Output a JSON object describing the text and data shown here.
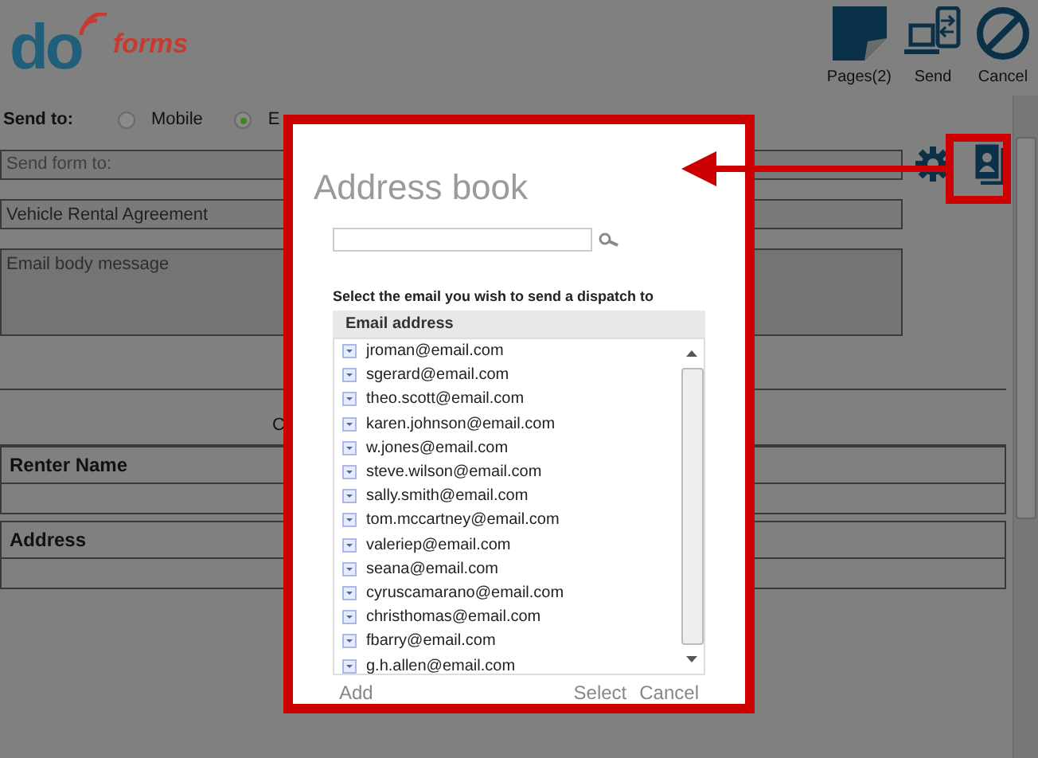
{
  "logo": {
    "mark": "do",
    "name": "forms"
  },
  "toolbar": [
    {
      "label": "Pages(2)",
      "kind": "pages"
    },
    {
      "label": "Send",
      "kind": "send"
    },
    {
      "label": "Cancel",
      "kind": "cancel"
    }
  ],
  "send_to": {
    "label": "Send to:",
    "options": [
      {
        "label": "Mobile",
        "selected": false
      },
      {
        "label": "E",
        "selected": true
      }
    ]
  },
  "recipient_field": {
    "placeholder": "Send form to:"
  },
  "subject_field": {
    "value": "Vehicle Rental Agreement"
  },
  "body_field": {
    "placeholder": "Email body message"
  },
  "section_label": "C",
  "form_fields": [
    {
      "label": "Renter Name"
    },
    {
      "label": "Address"
    }
  ],
  "dialog": {
    "title": "Address book",
    "instruction": "Select the email you wish to send a dispatch to",
    "column": "Email address",
    "emails": [
      "jroman@email.com",
      "sgerard@email.com",
      "theo.scott@email.com",
      "karen.johnson@email.com",
      "w.jones@email.com",
      "steve.wilson@email.com",
      "sally.smith@email.com",
      "tom.mccartney@email.com",
      "valeriep@email.com",
      "seana@email.com",
      "cyruscamarano@email.com",
      "christhomas@email.com",
      "fbarry@email.com",
      "g.h.allen@email.com"
    ],
    "actions": {
      "add": "Add",
      "select": "Select",
      "cancel": "Cancel"
    }
  }
}
